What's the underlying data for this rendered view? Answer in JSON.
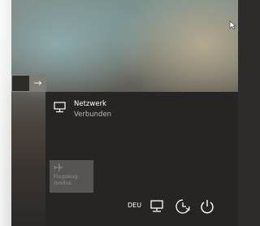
{
  "network": {
    "title": "Netzwerk",
    "status": "Verbunden"
  },
  "airplane_mode": {
    "label": "Flugzeug-\nmodus"
  },
  "taskbar": {
    "language": "DEU"
  },
  "password": {
    "submit_glyph": "→"
  }
}
